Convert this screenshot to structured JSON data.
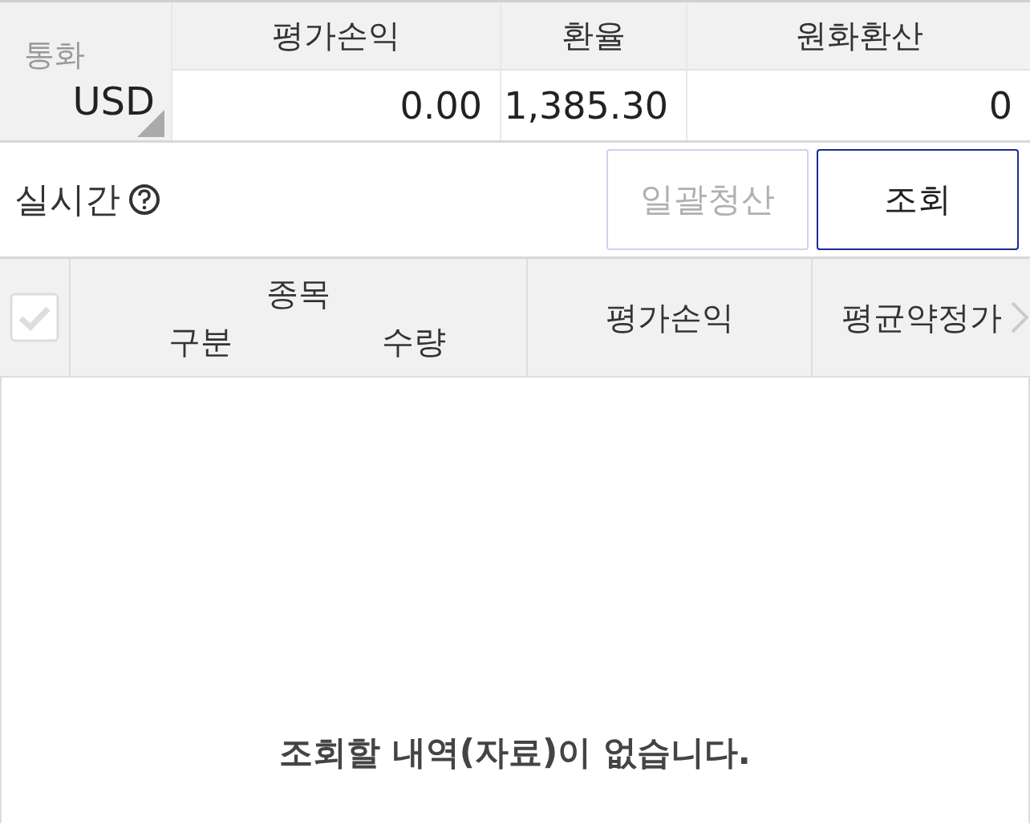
{
  "summary": {
    "currency_label": "통화",
    "currency": "USD",
    "columns": [
      {
        "header": "평가손익",
        "value": "0.00"
      },
      {
        "header": "환율",
        "value": "1,385.30"
      },
      {
        "header": "원화환산",
        "value": "0"
      }
    ]
  },
  "toolbar": {
    "label": "실시간",
    "buttons": [
      {
        "label": "일괄청산",
        "disabled": true
      },
      {
        "label": "조회",
        "disabled": false
      }
    ]
  },
  "table": {
    "select_all": {
      "disabled": true
    },
    "group_header": {
      "label": "종목",
      "sub_labels": [
        "구분",
        "수량"
      ]
    },
    "columns": [
      "평가손익",
      "평균약정가"
    ],
    "empty_message": "조회할 내역(자료)이 없습니다."
  }
}
